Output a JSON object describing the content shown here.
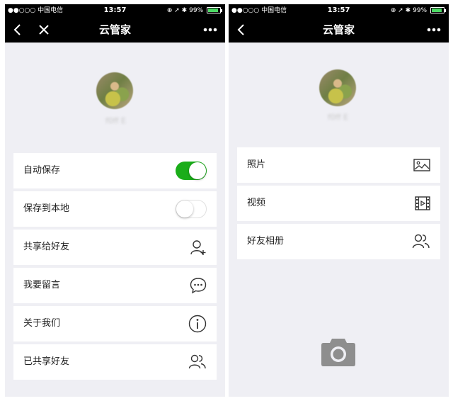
{
  "status_bar": {
    "carrier": "●●○○○ 中国电信",
    "time": "13:57",
    "battery": "99%",
    "indicators": "⊕ ➚ ✱"
  },
  "screen_left": {
    "title": "云管家",
    "icons": {
      "back": "chevron-left-icon",
      "close": "close-icon",
      "more": "more-dots-icon"
    },
    "username": "f0ff E",
    "settings": [
      {
        "label": "自动保存",
        "control": "toggle",
        "state": "on",
        "accent": "#1aad19"
      },
      {
        "label": "保存到本地",
        "control": "toggle",
        "state": "off"
      },
      {
        "label": "共享给好友",
        "control": "icon",
        "icon": "add-user-icon"
      },
      {
        "label": "我要留言",
        "control": "icon",
        "icon": "chat-bubble-icon"
      },
      {
        "label": "关于我们",
        "control": "icon",
        "icon": "info-icon"
      },
      {
        "label": "已共享好友",
        "control": "icon",
        "icon": "friends-icon"
      }
    ]
  },
  "screen_right": {
    "title": "云管家",
    "icons": {
      "back": "chevron-left-icon",
      "more": "more-dots-icon",
      "camera": "camera-icon"
    },
    "username": "f0ff E",
    "menu": [
      {
        "label": "照片",
        "icon": "photo-icon"
      },
      {
        "label": "视频",
        "icon": "video-film-icon"
      },
      {
        "label": "好友相册",
        "icon": "friends-icon"
      }
    ]
  }
}
